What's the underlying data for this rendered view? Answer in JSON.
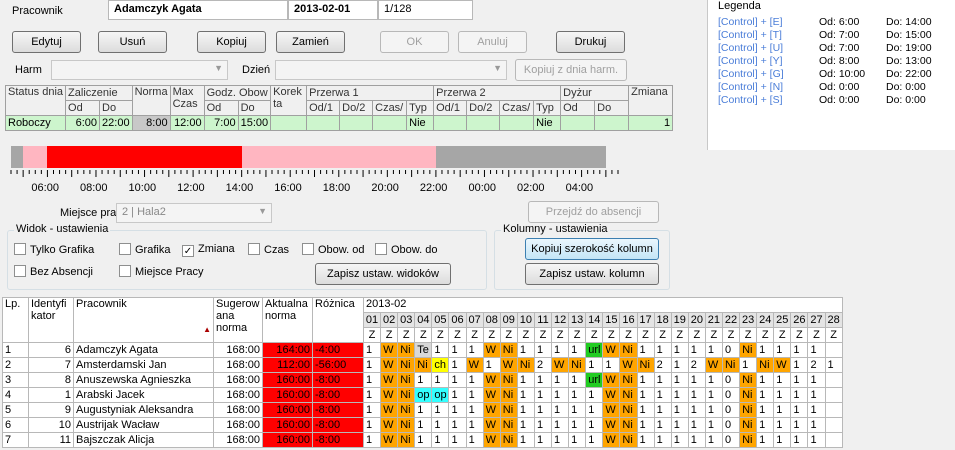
{
  "header": {
    "employee_label": "Pracownik",
    "employee_name": "Adamczyk Agata",
    "date": "2013-02-01",
    "counter": "1/128"
  },
  "buttons": {
    "edit": "Edytuj",
    "delete": "Usuń",
    "copy": "Kopiuj",
    "swap": "Zamień",
    "ok": "OK",
    "cancel": "Anuluj",
    "print": "Drukuj",
    "copy_from_day": "Kopiuj z dnia harm.",
    "go_absence": "Przejdź do absencji",
    "save_views": "Zapisz ustaw. widoków",
    "copy_col_width": "Kopiuj szerokość kolumn",
    "save_cols": "Zapisz ustaw. kolumn"
  },
  "filters": {
    "harm_label": "Harm",
    "day_label": "Dzień",
    "workplace_label": "Miejsce pracy:",
    "workplace_value": "2 | Hala2"
  },
  "legend": {
    "title": "Legenda",
    "rows": [
      {
        "key": "[Control] + [E]",
        "od": "Od:  6:00",
        "do": "Do:  14:00"
      },
      {
        "key": "[Control] + [T]",
        "od": "Od:  7:00",
        "do": "Do:  15:00"
      },
      {
        "key": "[Control] + [U]",
        "od": "Od:  7:00",
        "do": "Do:  19:00"
      },
      {
        "key": "[Control] + [Y]",
        "od": "Od:  8:00",
        "do": "Do:  13:00"
      },
      {
        "key": "[Control] + [G]",
        "od": "Od:  10:00",
        "do": "Do:  22:00"
      },
      {
        "key": "[Control] + [N]",
        "od": "Od:  0:00",
        "do": "Do:  0:00"
      },
      {
        "key": "[Control] + [S]",
        "od": "Od:  0:00",
        "do": "Do:  0:00"
      }
    ]
  },
  "shift": {
    "h1": [
      "Status dnia",
      "Zaliczenie",
      "Norma",
      "Max Czas",
      "Godz. Obow",
      "Korek ta",
      "Przerwa 1",
      "Przerwa 2",
      "Dyżur",
      "Zmiana"
    ],
    "h2": [
      "Od",
      "Do",
      "Od",
      "Do",
      "Od/1",
      "Do/2",
      "Czas/",
      "Typ",
      "Od/1",
      "Do/2",
      "Czas/",
      "Typ",
      "Od",
      "Do"
    ],
    "values": [
      "Roboczy",
      "6:00",
      "22:00",
      "8:00",
      "12:00",
      "7:00",
      "15:00",
      "",
      "",
      "",
      "",
      "Nie",
      "",
      "",
      "",
      "Nie",
      "",
      "",
      "1"
    ]
  },
  "timeline": {
    "segments": [
      {
        "from": 4.0,
        "to": 5.0,
        "color": "#a6a6a6"
      },
      {
        "from": 5.0,
        "to": 6.0,
        "color": "#ffb6c1"
      },
      {
        "from": 6.0,
        "to": 14.0,
        "color": "#ff0000"
      },
      {
        "from": 14.0,
        "to": 22.0,
        "color": "#ffb6c1"
      },
      {
        "from": 22.0,
        "to": 29.0,
        "color": "#a6a6a6"
      }
    ],
    "labels": [
      "06:00",
      "08:00",
      "10:00",
      "12:00",
      "14:00",
      "16:00",
      "18:00",
      "20:00",
      "22:00",
      "00:00",
      "02:00",
      "04:00"
    ]
  },
  "view_settings": {
    "title": "Widok - ustawienia",
    "only_graph": "Tylko Grafika",
    "graph": "Grafika",
    "shift": "Zmiana",
    "time": "Czas",
    "obl_od": "Obow. od",
    "obl_do": "Obow. do",
    "no_absences": "Bez Absencji",
    "workplace": "Miejsce Pracy",
    "only_graph_checked": false,
    "graph_checked": false,
    "shift_checked": true,
    "time_checked": false,
    "obl_od_checked": false,
    "obl_do_checked": false,
    "no_abs_checked": false,
    "workplace_checked": false
  },
  "column_settings": {
    "title": "Kolumny - ustawienia"
  },
  "grid": {
    "headers": {
      "lp": "Lp.",
      "id": "Identyfi kator",
      "name": "Pracownik",
      "suggested": "Sugerow ana norma",
      "actual": "Aktualna norma",
      "diff": "Różnica",
      "month": "2013-02"
    },
    "days": [
      "01",
      "02",
      "03",
      "04",
      "05",
      "06",
      "07",
      "08",
      "09",
      "10",
      "11",
      "12",
      "13",
      "14",
      "15",
      "16",
      "17",
      "18",
      "19",
      "20",
      "21",
      "22",
      "23",
      "24",
      "25",
      "26",
      "27",
      "28"
    ],
    "day_letters": [
      "Z",
      "Z",
      "Z",
      "Z",
      "Z",
      "Z",
      "Z",
      "Z",
      "Z",
      "Z",
      "Z",
      "Z",
      "Z",
      "Z",
      "Z",
      "Z",
      "Z",
      "Z",
      "Z",
      "Z",
      "Z",
      "Z",
      "Z",
      "Z",
      "Z",
      "Z",
      "Z",
      "Z"
    ],
    "rows": [
      {
        "lp": "1",
        "id": "6",
        "name": "Adamczyk Agata",
        "sug": "168:00",
        "act": "164:00",
        "diff": "-4:00",
        "cells": [
          "1",
          "W",
          "Ni",
          "Te",
          "1",
          "1",
          "1",
          "W",
          "Ni",
          "1",
          "1",
          "1",
          "1",
          "url",
          "W",
          "Ni",
          "1",
          "1",
          "1",
          "1",
          "1",
          "0",
          "Ni",
          "1",
          "1",
          "1",
          "1",
          ""
        ]
      },
      {
        "lp": "2",
        "id": "7",
        "name": "Amsterdamski Jan",
        "sug": "168:00",
        "act": "112:00",
        "diff": "-56:00",
        "cells": [
          "1",
          "W",
          "Ni",
          "Ni",
          "ch",
          "1",
          "W",
          "1",
          "W",
          "Ni",
          "2",
          "W",
          "Ni",
          "1",
          "1",
          "W",
          "Ni",
          "2",
          "1",
          "2",
          "W",
          "Ni",
          "1",
          "Ni",
          "W",
          "1",
          "2",
          "1"
        ]
      },
      {
        "lp": "3",
        "id": "8",
        "name": "Anuszewska Agnieszka",
        "sug": "168:00",
        "act": "160:00",
        "diff": "-8:00",
        "cells": [
          "1",
          "W",
          "Ni",
          "1",
          "1",
          "1",
          "1",
          "W",
          "Ni",
          "1",
          "1",
          "1",
          "1",
          "url",
          "W",
          "Ni",
          "1",
          "1",
          "1",
          "1",
          "1",
          "0",
          "Ni",
          "1",
          "1",
          "1",
          "1",
          ""
        ]
      },
      {
        "lp": "4",
        "id": "1",
        "name": "Arabski Jacek",
        "sug": "168:00",
        "act": "160:00",
        "diff": "-8:00",
        "cells": [
          "1",
          "W",
          "Ni",
          "op",
          "op",
          "1",
          "1",
          "W",
          "Ni",
          "1",
          "1",
          "1",
          "1",
          "1",
          "W",
          "Ni",
          "1",
          "1",
          "1",
          "1",
          "1",
          "0",
          "Ni",
          "1",
          "1",
          "1",
          "1",
          ""
        ]
      },
      {
        "lp": "5",
        "id": "9",
        "name": "Augustyniak Aleksandra",
        "sug": "168:00",
        "act": "160:00",
        "diff": "-8:00",
        "cells": [
          "1",
          "W",
          "Ni",
          "1",
          "1",
          "1",
          "1",
          "W",
          "Ni",
          "1",
          "1",
          "1",
          "1",
          "1",
          "W",
          "Ni",
          "1",
          "1",
          "1",
          "1",
          "1",
          "0",
          "Ni",
          "1",
          "1",
          "1",
          "1",
          ""
        ]
      },
      {
        "lp": "6",
        "id": "10",
        "name": "Austrijak Wacław",
        "sug": "168:00",
        "act": "160:00",
        "diff": "-8:00",
        "cells": [
          "1",
          "W",
          "Ni",
          "1",
          "1",
          "1",
          "1",
          "W",
          "Ni",
          "1",
          "1",
          "1",
          "1",
          "1",
          "W",
          "Ni",
          "1",
          "1",
          "1",
          "1",
          "1",
          "0",
          "Ni",
          "1",
          "1",
          "1",
          "1",
          ""
        ]
      },
      {
        "lp": "7",
        "id": "11",
        "name": "Bajszczak Alicja",
        "sug": "168:00",
        "act": "160:00",
        "diff": "-8:00",
        "cells": [
          "1",
          "W",
          "Ni",
          "1",
          "1",
          "1",
          "1",
          "W",
          "Ni",
          "1",
          "1",
          "1",
          "1",
          "1",
          "W",
          "Ni",
          "1",
          "1",
          "1",
          "1",
          "1",
          "0",
          "Ni",
          "1",
          "1",
          "1",
          "1",
          ""
        ]
      }
    ],
    "colors": {
      "W": "#ffa500",
      "Ni": "#ffa500",
      "url": "#22cc22",
      "op": "#33ffff",
      "ch": "#ffff00",
      "Te": "#d8d8d8",
      "act": "#ff0000"
    }
  }
}
